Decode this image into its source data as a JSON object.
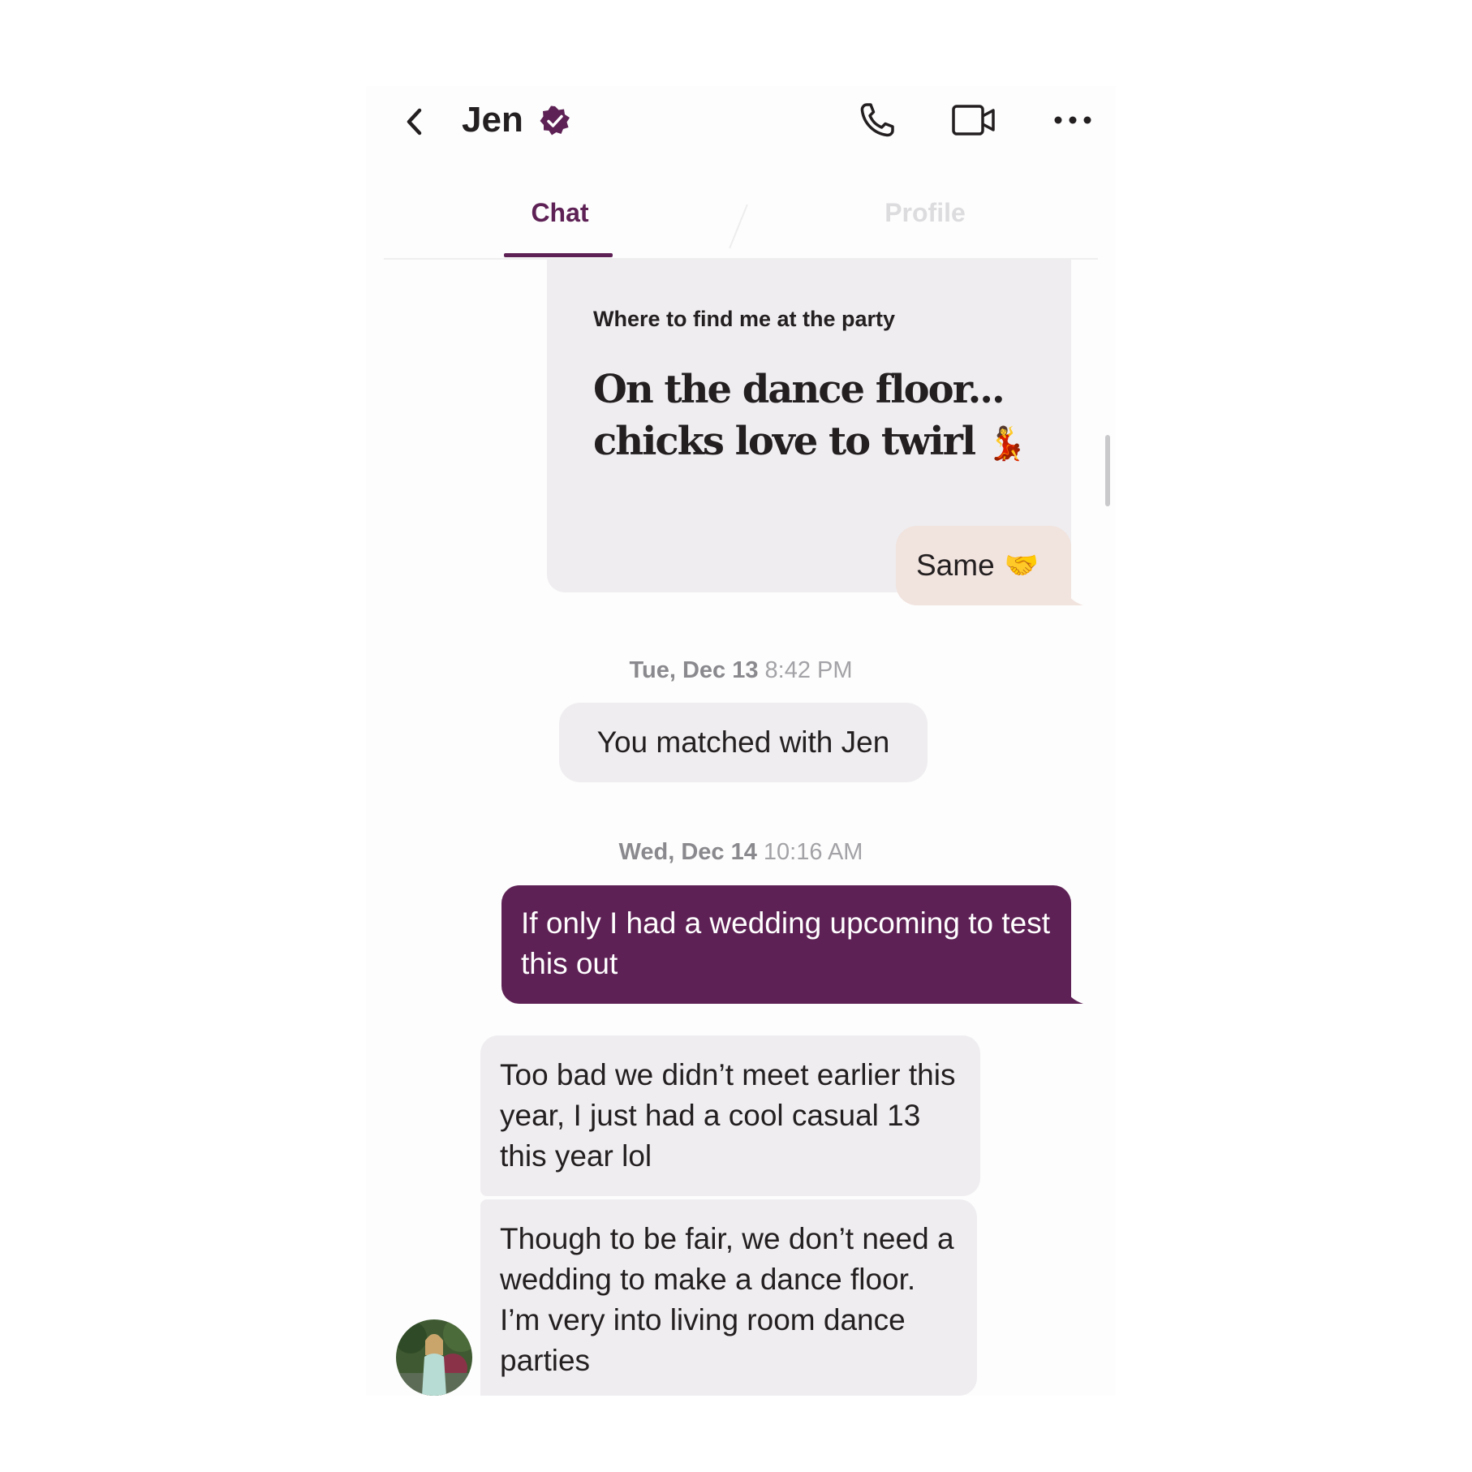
{
  "header": {
    "contact_name": "Jen",
    "back_icon": "chevron-left-icon",
    "verified_icon": "verified-badge-icon",
    "call_icon": "phone-icon",
    "video_icon": "video-camera-icon",
    "more_icon": "more-horizontal-icon"
  },
  "tabs": [
    {
      "label": "Chat",
      "active": true
    },
    {
      "label": "Profile",
      "active": false
    }
  ],
  "colors": {
    "accent": "#5e2155",
    "bubble_incoming": "#efedf0",
    "bubble_reply": "#f1e3de"
  },
  "prompt": {
    "question": "Where to find me at the party",
    "answer_line1": "On the dance floor...",
    "answer_line2": "chicks love to twirl",
    "answer_emoji": "💃",
    "reply_text": "Same",
    "reply_emoji": "🤝"
  },
  "timestamps": [
    {
      "day": "Tue, Dec 13",
      "time": "8:42 PM"
    },
    {
      "day": "Wed, Dec 14",
      "time": "10:16 AM"
    }
  ],
  "system_message": "You matched with Jen",
  "messages": [
    {
      "from": "me",
      "text": "If only I had a wedding upcoming to test this out"
    },
    {
      "from": "Jen",
      "text": "Too bad we didn’t meet earlier this year, I just had a cool casual 13 this year lol"
    },
    {
      "from": "Jen",
      "text": "Though to be fair, we don’t need a wedding to make a dance floor. I’m very into living room dance parties"
    }
  ]
}
